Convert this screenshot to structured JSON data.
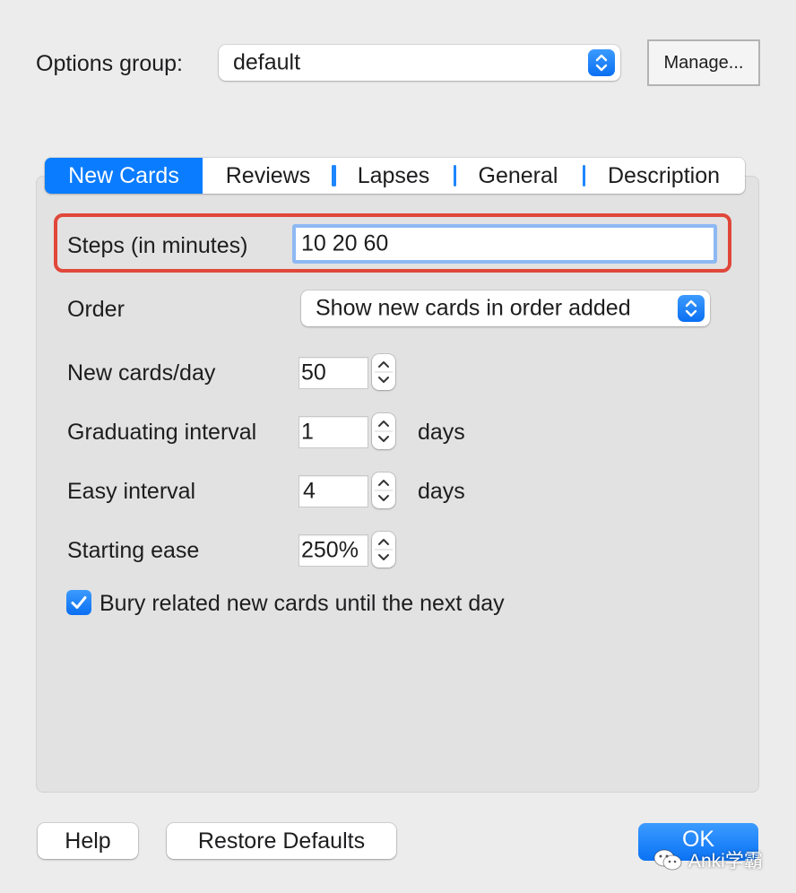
{
  "header": {
    "options_group_label": "Options group:",
    "options_group_value": "default",
    "manage_label": "Manage..."
  },
  "tabs": [
    {
      "label": "New Cards",
      "active": true
    },
    {
      "label": "Reviews",
      "active": false
    },
    {
      "label": "Lapses",
      "active": false
    },
    {
      "label": "General",
      "active": false
    },
    {
      "label": "Description",
      "active": false
    }
  ],
  "new_cards": {
    "steps_label": "Steps (in minutes)",
    "steps_value": "10 20 60",
    "order_label": "Order",
    "order_value": "Show new cards in order added",
    "new_per_day_label": "New cards/day",
    "new_per_day_value": "50",
    "graduating_label": "Graduating interval",
    "graduating_value": "1",
    "graduating_unit": "days",
    "easy_label": "Easy interval",
    "easy_value": "4",
    "easy_unit": "days",
    "ease_label": "Starting ease",
    "ease_value": "250%",
    "bury_label": "Bury related new cards until the next day",
    "bury_checked": true
  },
  "footer": {
    "help_label": "Help",
    "restore_label": "Restore Defaults",
    "ok_label": "OK"
  },
  "watermark": {
    "text": "Anki学霸",
    "icon": "wechat-icon"
  },
  "colors": {
    "accent": "#0a7cff",
    "highlight_outline": "#e0473a",
    "focus_ring": "#8db8f3",
    "background": "#ececec",
    "panel": "#e2e2e2"
  }
}
